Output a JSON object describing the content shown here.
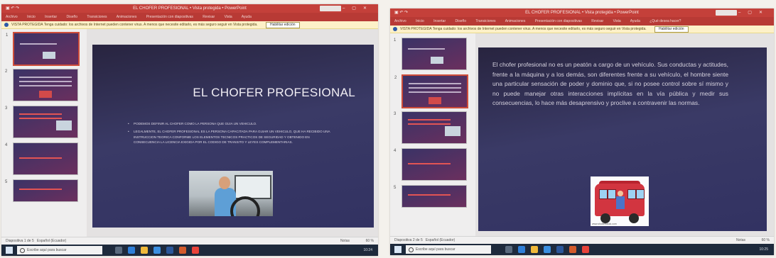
{
  "left": {
    "window_title": "EL CHOFER PROFESIONAL • Vista protegida • PowerPoint",
    "ribbon_tabs": [
      "Archivo",
      "Inicio",
      "Insertar",
      "Diseño",
      "Transiciones",
      "Animaciones",
      "Presentación con diapositivas",
      "Revisar",
      "Vista",
      "Ayuda"
    ],
    "protected_view": {
      "label": "VISTA PROTEGIDA",
      "message": "Tenga cuidado: los archivos de Internet pueden contener virus. A menos que necesite editarlo, es más seguro seguir en Vista protegida.",
      "button": "Habilitar edición"
    },
    "thumbnail_numbers": [
      "1",
      "2",
      "3",
      "4",
      "5"
    ],
    "slide": {
      "title": "EL CHOFER PROFESIONAL",
      "bullets": [
        "PODEMOS DEFINIR AL CHOFER COMO LA PERSONA QUE GUIA UN VEHICULO.",
        "LEGALMENTE, EL CHOFER PROFESIONAL ES LA PERSONA CAPACITADA PARA GUIAR UN VEHICULO, QUE HA RECIBIDO UNA INSTRUCCION TEORICA CONFORME LOS ELEMENTOS TECNICOS PRACTICOS DE SEGURIDAD Y OBTENIDO EN CONSECUENCIA LA LICENCIA EXIGIDA POR EL CODIGO DE TRANSITO Y LEYES COMPLEMENTARIAS."
      ]
    },
    "status": {
      "slide_count": "Diapositiva 1 de 5",
      "language": "Español (Ecuador)",
      "notes": "Notas",
      "zoom": "60 %"
    },
    "taskbar": {
      "search_placeholder": "Escribe aquí para buscar",
      "clock": "10:24"
    }
  },
  "right": {
    "window_title": "EL CHOFER PROFESIONAL • Vista protegida • PowerPoint",
    "ribbon_tabs": [
      "Archivo",
      "Inicio",
      "Insertar",
      "Diseño",
      "Transiciones",
      "Animaciones",
      "Presentación con diapositivas",
      "Revisar",
      "Vista",
      "Ayuda",
      "¿Qué desea hacer?"
    ],
    "protected_view": {
      "label": "VISTA PROTEGIDA",
      "message": "Tenga cuidado: los archivos de Internet pueden contener virus. A menos que necesite editarlo, es más seguro seguir en Vista protegida.",
      "button": "Habilitar edición"
    },
    "thumbnail_numbers": [
      "1",
      "2",
      "3",
      "4",
      "5"
    ],
    "slide": {
      "body": "El chofer profesional no es un peatón a cargo de un vehículo. Sus conductas y actitudes, frente a la máquina y a los demás, son diferentes frente a su vehículo, el hombre siente una particular sensación de poder y dominio que, si no posee control sobre sí mismo y no puede manejar otras interacciones implícitas en la vía pública y medir sus consecuencias, lo hace más desaprensivo y proclive a contravenir las normas.",
      "image_caption": "www.shutterstock.com"
    },
    "status": {
      "slide_count": "Diapositiva 2 de 5",
      "language": "Español (Ecuador)",
      "notes": "Notas",
      "zoom": "60 %"
    },
    "taskbar": {
      "search_placeholder": "Escribe aquí para buscar",
      "clock": "10:25"
    }
  }
}
